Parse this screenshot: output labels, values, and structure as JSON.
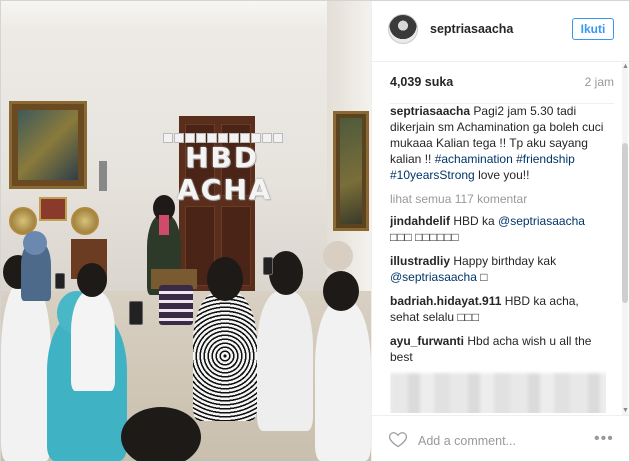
{
  "post": {
    "username": "septriasaacha",
    "follow_label": "Ikuti",
    "likes": "4,039 suka",
    "timestamp": "2 jam",
    "caption_user": "septriasaacha",
    "caption_text": "Pagi2 jam 5.30 tadi dikerjain sm Achamination ga boleh cuci mukaaa Kalian tega !! Tp aku sayang kalian !!",
    "caption_tags": "#achamination #friendship #10yearsStrong",
    "caption_end": "love you!!",
    "view_all": "lihat semua 117 komentar"
  },
  "comments": [
    {
      "user": "jindahdelif",
      "text": "HBD ka",
      "tag": "@septriasaacha",
      "tail": "□□□ □□□□□□"
    },
    {
      "user": "illustradliy",
      "text": "Happy birthday kak",
      "tag": "@septriasaacha",
      "tail": "□"
    },
    {
      "user": "badriah.hidayat.911",
      "text": "HBD ka acha, sehat selalu",
      "tag": "",
      "tail": "□□□"
    },
    {
      "user": "ayu_furwanti",
      "text": "Hbd acha wish u all the best",
      "tag": "",
      "tail": ""
    }
  ],
  "footer": {
    "add_comment_placeholder": "Add a comment...",
    "more_label": "•••"
  },
  "photo": {
    "banner_text": "HAPPY BIRTHDAY",
    "balloon_line1": "HBD",
    "balloon_line2": "ACHA"
  },
  "scrollbar": {
    "up": "▲",
    "down": "▼"
  },
  "colors": {
    "accent": "#3897f0",
    "link": "#003569",
    "muted": "#999999"
  }
}
